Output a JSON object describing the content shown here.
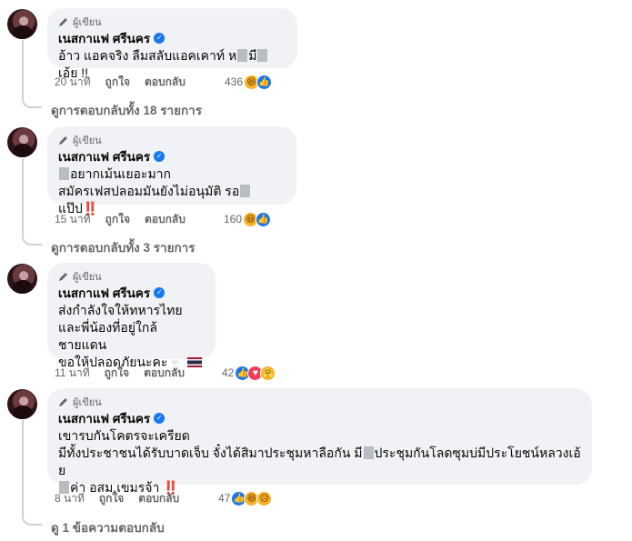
{
  "author_badge": "ผู้เขียน",
  "author_name": "เนสกาแฟ ศรีนคร",
  "like_label": "ถูกใจ",
  "reply_label": "ตอบกลับ",
  "comments": [
    {
      "time": "20 นาที",
      "line1_a": "อ้าว แอคจริง ลืมสลับแอคเคาท์ ห",
      "line1_b": "มี",
      "line1_c": "เอ้ย !!",
      "react_count": "436",
      "reactions": [
        "haha-icon",
        "like-icon"
      ],
      "more_replies": "ดูการตอบกลับทั้ง 18 รายการ"
    },
    {
      "time": "15 นาที",
      "line1": "อยากเม้นเยอะมาก",
      "line2_a": "สมัครเฟสปลอมมันยังไม่อนุมัติ รอ",
      "line2_b": "แป๊ป",
      "bang": "‼️",
      "react_count": "160",
      "reactions": [
        "haha-icon",
        "like-icon"
      ],
      "more_replies": "ดูการตอบกลับทั้ง 3 รายการ"
    },
    {
      "time": "11 นาที",
      "line1": "ส่งกำลังใจให้ทหารไทย",
      "line2": "และพี่น้องที่อยู่ใกล้ชายแดน",
      "line3": "ขอให้ปลอดภัยนะคะ",
      "react_count": "42",
      "reactions": [
        "like-icon",
        "love-icon",
        "care-icon"
      ]
    },
    {
      "time": "8 นาที",
      "line1": "เขารบกันโคตรจะเครียด",
      "line2_a": "มีทั้งประชาชนได้รับบาดเจ็บ จั๋งได้สิมาประชุมหาลือกัน มี",
      "line2_b": "ประชุมกันโลดซุมบ่มีประโยชน์หลวงเอ้ย",
      "line3": "ค่า อสม.เขมรจ้า",
      "bang": "‼️",
      "react_count": "47",
      "reactions": [
        "like-icon",
        "haha-icon",
        "sad-icon"
      ],
      "more_replies": "ดู 1 ข้อความตอบกลับ"
    }
  ]
}
